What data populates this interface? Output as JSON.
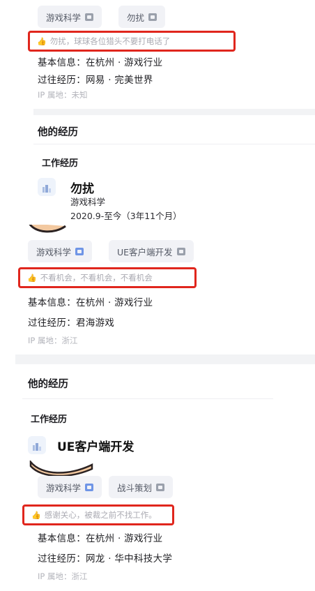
{
  "card1": {
    "tags": [
      {
        "label": "游戏科学",
        "icon": "tag-grey-icon"
      },
      {
        "label": "勿扰",
        "icon": "tag-grey-icon"
      }
    ],
    "status_text": "勿扰，球球各位猎头不要打电话了",
    "basic_info": "基本信息：在杭州 · 游戏行业",
    "past_experience": "过往经历：网易 · 完美世界",
    "ip_location": "IP 属地：未知",
    "experience_section_title": "他的经历",
    "work_title": "工作经历",
    "job": {
      "company": "勿扰",
      "employer": "游戏科学",
      "period": "2020.9-至今（3年11个月）"
    }
  },
  "card2": {
    "tags": [
      {
        "label": "游戏科学",
        "icon": "verified-blue-icon"
      },
      {
        "label": "UE客户端开发",
        "icon": "tag-grey-icon"
      }
    ],
    "status_text": "不看机会，不看机会，不看机会",
    "basic_info": "基本信息：在杭州 · 游戏行业",
    "past_experience": "过往经历：君海游戏",
    "ip_location": "IP 属地：浙江",
    "experience_section_title": "他的经历",
    "work_title": "工作经历",
    "job": {
      "company": "UE客户端开发"
    }
  },
  "card3": {
    "tags": [
      {
        "label": "游戏科学",
        "icon": "verified-blue-icon"
      },
      {
        "label": "战斗策划",
        "icon": "tag-grey-icon"
      }
    ],
    "status_text": "感谢关心，被裁之前不找工作。",
    "basic_info": "基本信息：在杭州 · 游戏行业",
    "past_experience": "过往经历：网龙 · 华中科技大学",
    "ip_location": "IP 属地：浙江"
  },
  "colors": {
    "highlight_border": "#e0261d",
    "tag_bg": "#f1f2f6",
    "verified_icon": "#6f95e6",
    "separator": "#f2f3f5"
  }
}
